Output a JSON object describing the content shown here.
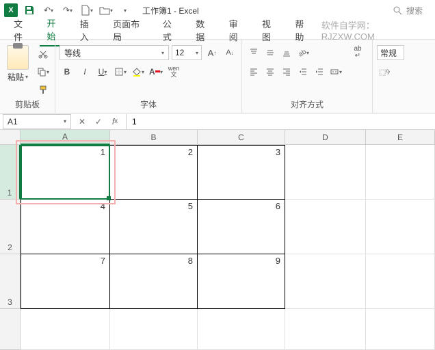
{
  "title": "工作簿1 - Excel",
  "search_placeholder": "搜索",
  "tabs": {
    "file": "文件",
    "home": "开始",
    "insert": "插入",
    "layout": "页面布局",
    "formula": "公式",
    "data": "数据",
    "review": "审阅",
    "view": "视图",
    "help": "帮助"
  },
  "watermark": "软件自学网：RJZXW.COM",
  "ribbon": {
    "clipboard": {
      "label": "剪贴板",
      "paste": "粘贴"
    },
    "font": {
      "label": "字体",
      "name": "等线",
      "size": "12",
      "bold": "B",
      "italic": "I",
      "underline": "U",
      "wen": "wen\n文"
    },
    "align": {
      "label": "对齐方式",
      "wrap": "ab\n↵"
    },
    "number": {
      "label_general": "常规"
    }
  },
  "namebox": "A1",
  "formula": "1",
  "columns": [
    "A",
    "B",
    "C",
    "D",
    "E"
  ],
  "rows": [
    "1",
    "2",
    "3"
  ],
  "cells": {
    "r1": {
      "a": "1",
      "b": "2",
      "c": "3"
    },
    "r2": {
      "a": "4",
      "b": "5",
      "c": "6"
    },
    "r3": {
      "a": "7",
      "b": "8",
      "c": "9"
    }
  }
}
